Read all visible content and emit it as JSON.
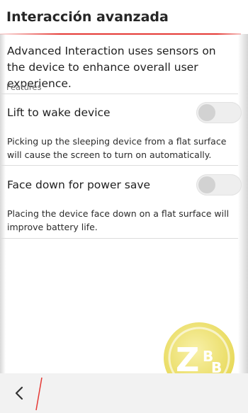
{
  "header": {
    "title": "Interacción avanzada"
  },
  "intro": {
    "description": "Advanced Interaction uses sensors on the device to enhance overall user experience."
  },
  "features": {
    "section_label": "Features",
    "items": [
      {
        "label": "Lift to wake device",
        "help": "Picking up the sleeping device from a flat surface will cause the screen to turn on automatically.",
        "enabled": false
      },
      {
        "label": "Face down for power save",
        "help": "Placing the device face down on a flat surface will improve battery life.",
        "enabled": false
      }
    ]
  },
  "navigation": {
    "back_icon": "chevron-left-icon"
  },
  "watermark": {
    "text": "ZBB"
  },
  "colors": {
    "accent": "#e53935",
    "watermark": "#e8d640"
  }
}
